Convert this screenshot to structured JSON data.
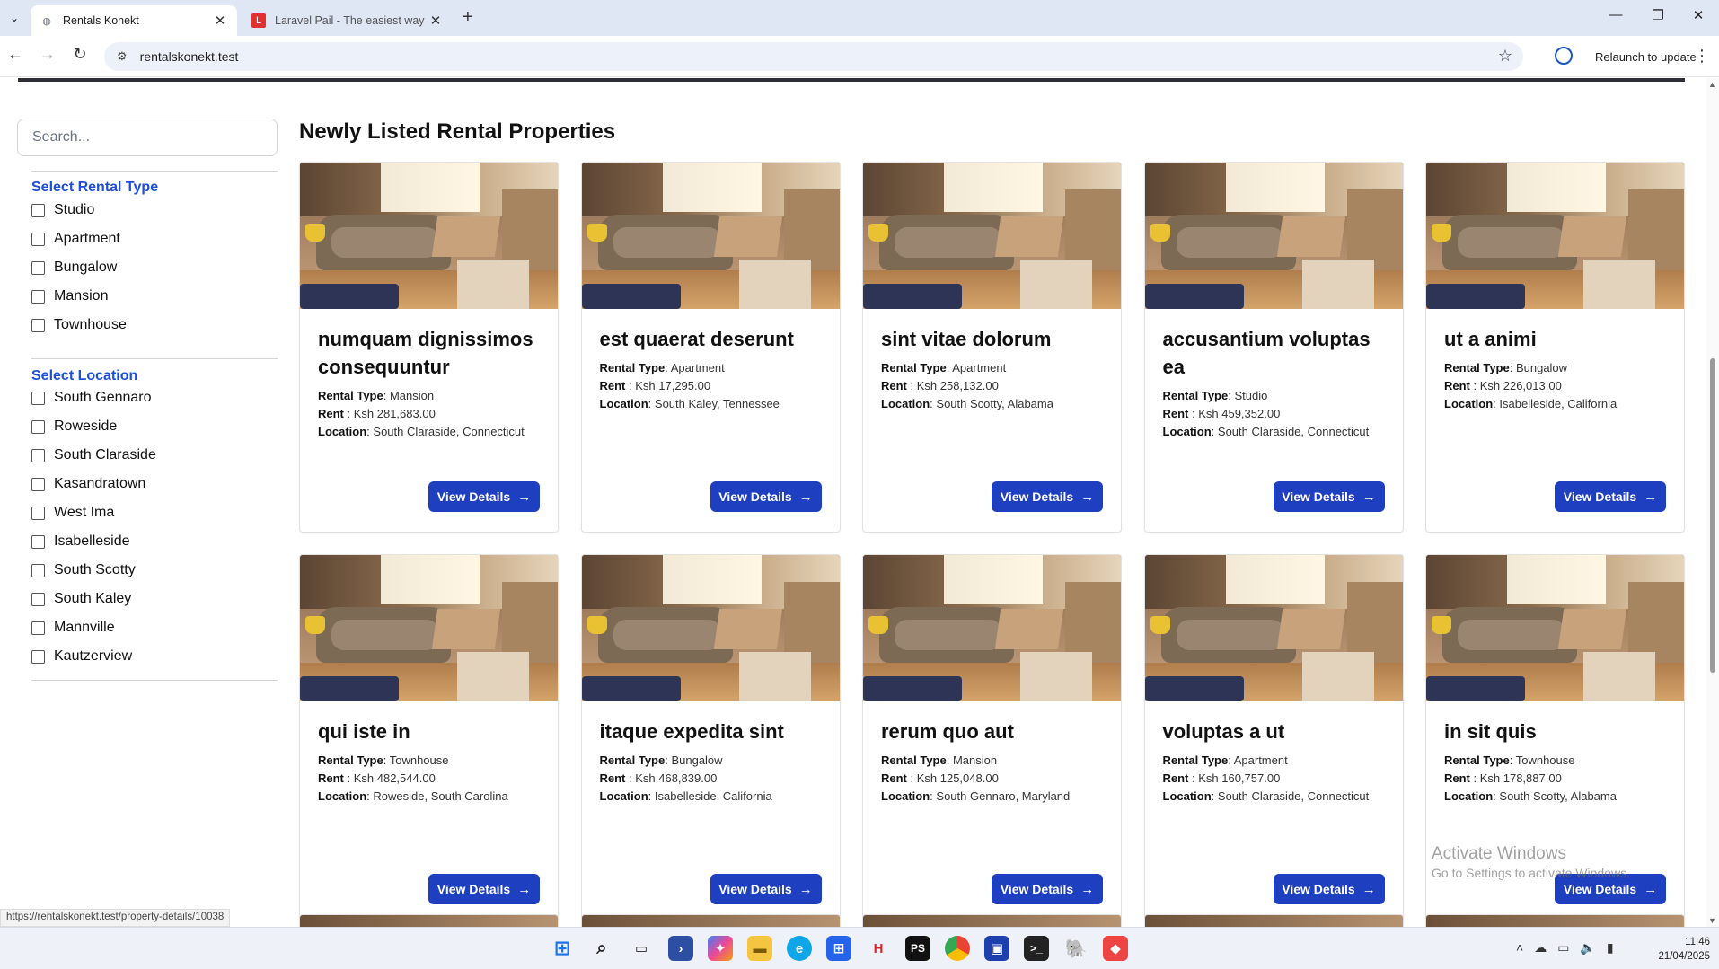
{
  "browser": {
    "tabs": [
      {
        "label": "Rentals Konekt",
        "active": true
      },
      {
        "label": "Laravel Pail - The easiest way to",
        "active": false
      }
    ],
    "new_tab": "+",
    "url": "rentalskonekt.test",
    "relaunch_label": "Relaunch to update",
    "status_url": "https://rentalskonekt.test/property-details/10038"
  },
  "sidebar": {
    "search_placeholder": "Search...",
    "rental_type_title": "Select Rental Type",
    "rental_types": [
      "Studio",
      "Apartment",
      "Bungalow",
      "Mansion",
      "Townhouse"
    ],
    "location_title": "Select Location",
    "locations": [
      "South Gennaro",
      "Roweside",
      "South Claraside",
      "Kasandratown",
      "West Ima",
      "Isabelleside",
      "South Scotty",
      "South Kaley",
      "Mannville",
      "Kautzerview"
    ]
  },
  "main": {
    "section_title": "Newly Listed Rental Properties",
    "labels": {
      "type": "Rental Type",
      "rent": "Rent",
      "location": "Location",
      "button": "View Details"
    },
    "properties": [
      {
        "title": "numquam dignissimos consequuntur",
        "type": "Mansion",
        "rent": "Ksh 281,683.00",
        "location": "South Claraside, Connecticut"
      },
      {
        "title": "est quaerat deserunt",
        "type": "Apartment",
        "rent": "Ksh 17,295.00",
        "location": "South Kaley, Tennessee"
      },
      {
        "title": "sint vitae dolorum",
        "type": "Apartment",
        "rent": "Ksh 258,132.00",
        "location": "South Scotty, Alabama"
      },
      {
        "title": "accusantium voluptas ea",
        "type": "Studio",
        "rent": "Ksh 459,352.00",
        "location": "South Claraside, Connecticut"
      },
      {
        "title": "ut a animi",
        "type": "Bungalow",
        "rent": "Ksh 226,013.00",
        "location": "Isabelleside, California"
      },
      {
        "title": "qui iste in",
        "type": "Townhouse",
        "rent": "Ksh 482,544.00",
        "location": "Roweside, South Carolina"
      },
      {
        "title": "itaque expedita sint",
        "type": "Bungalow",
        "rent": "Ksh 468,839.00",
        "location": "Isabelleside, California"
      },
      {
        "title": "rerum quo aut",
        "type": "Mansion",
        "rent": "Ksh 125,048.00",
        "location": "South Gennaro, Maryland"
      },
      {
        "title": "voluptas a ut",
        "type": "Apartment",
        "rent": "Ksh 160,757.00",
        "location": "South Claraside, Connecticut"
      },
      {
        "title": "in sit quis",
        "type": "Townhouse",
        "rent": "Ksh 178,887.00",
        "location": "South Scotty, Alabama"
      }
    ]
  },
  "watermark": {
    "line1": "Activate Windows",
    "line2": "Go to Settings to activate Windows."
  },
  "taskbar": {
    "icons": [
      "windows-start-icon",
      "search-icon",
      "task-view-icon",
      "powershell-icon",
      "copilot-icon",
      "file-explorer-icon",
      "edge-icon",
      "store-icon",
      "heidisql-icon",
      "phpstorm-icon",
      "chrome-icon",
      "remote-desktop-icon",
      "terminal-icon",
      "postgres-icon",
      "git-icon"
    ],
    "time": "11:46",
    "date": "21/04/2025"
  }
}
